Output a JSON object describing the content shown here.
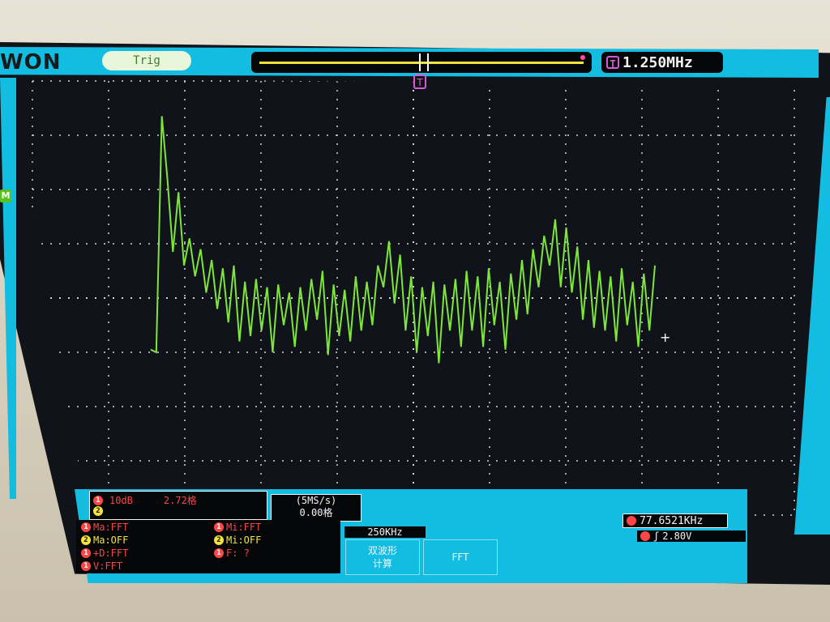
{
  "brand": "WON",
  "trigger_state": "Trig",
  "trigger_readout": "1.250MHz",
  "trigger_icon": "T",
  "trigger_position_icon": "T",
  "math_marker": "M",
  "channel_box": {
    "ch1_scale": "10dB",
    "ch1_offset": "2.72格",
    "ch1_num": "1",
    "ch2_num": "2"
  },
  "sample": {
    "rate": "(5MS/s)",
    "offset": "0.00格"
  },
  "freq_readout": "77.6521KHz",
  "span": "250KHz",
  "trigger_level": "2.80V",
  "measurements": [
    {
      "num": "1",
      "color": "#ff4545",
      "text": "Ma:FFT"
    },
    {
      "num": "2",
      "color": "#f4e33a",
      "text": "Ma:OFF"
    },
    {
      "num": "1",
      "color": "#ff4545",
      "text": "+D:FFT"
    },
    {
      "num": "1",
      "color": "#ff4545",
      "text": "V:FFT"
    },
    {
      "num": "1",
      "color": "#ff4545",
      "text": "Mi:FFT"
    },
    {
      "num": "2",
      "color": "#f4e33a",
      "text": "Mi:OFF"
    },
    {
      "num": "1",
      "color": "#ff4545",
      "text": "F:  ?"
    }
  ],
  "softkeys": {
    "dual_label_line1": "双波形",
    "dual_label_line2": "计算",
    "fft_label": "FFT"
  },
  "colors": {
    "accent": "#13bde2",
    "trace": "#7ee53a",
    "trigger": "#d35bd8",
    "ch1": "#ff4545",
    "ch2": "#f4e33a"
  },
  "chart_data": {
    "type": "line",
    "series": [
      {
        "values": [
          -0.95,
          -1.0,
          3.35,
          2.2,
          0.85,
          1.95,
          0.6,
          1.1,
          0.4,
          0.9,
          0.1,
          0.7,
          -0.2,
          0.55,
          -0.45,
          0.6,
          -0.8,
          0.3,
          -0.7,
          0.35,
          -0.6,
          0.2,
          -1.0,
          0.25,
          -0.5,
          0.1,
          -0.9,
          0.2,
          -0.6,
          0.35,
          -0.4,
          0.5,
          -1.05,
          0.25,
          -0.7,
          0.15,
          -0.8,
          0.4,
          -0.6,
          0.3,
          -0.5,
          0.6,
          0.2,
          1.05,
          -0.1,
          0.8,
          -0.6,
          0.4,
          -1.0,
          0.2,
          -0.7,
          0.3,
          -1.2,
          0.25,
          -0.6,
          0.35,
          -0.9,
          0.5,
          -0.6,
          0.4,
          -0.9,
          0.55,
          -0.5,
          0.3,
          -0.95,
          0.45,
          -0.4,
          0.7,
          -0.3,
          0.9,
          0.2,
          1.15,
          0.6,
          1.45,
          0.2,
          1.3,
          0.1,
          0.95,
          -0.4,
          0.7,
          -0.55,
          0.5,
          -0.6,
          0.4,
          -0.8,
          0.55,
          -0.5,
          0.3,
          -0.9,
          0.45,
          -0.6,
          0.6
        ]
      }
    ],
    "xlim": [
      0,
      250
    ],
    "ylim": [
      -4,
      4
    ],
    "grid": true
  }
}
